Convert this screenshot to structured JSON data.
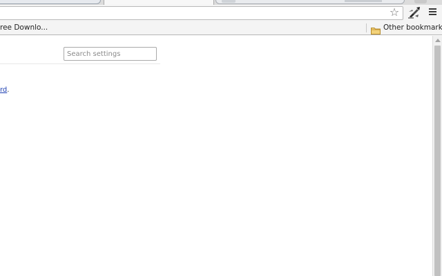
{
  "bookmarks_bar": {
    "left_item": "ree Downlo...",
    "other_bookmarks": "Other bookmarks"
  },
  "settings": {
    "search_placeholder": "Search settings",
    "link_text": "rd",
    "link_trailing": "."
  },
  "icons": {
    "star": "star-icon",
    "extension": "extension-icon",
    "menu": "menu-icon",
    "folder": "folder-icon"
  },
  "colors": {
    "link": "#1a3cb0",
    "folder": "#e8c15a",
    "toolbar": "#f4f4f4"
  }
}
